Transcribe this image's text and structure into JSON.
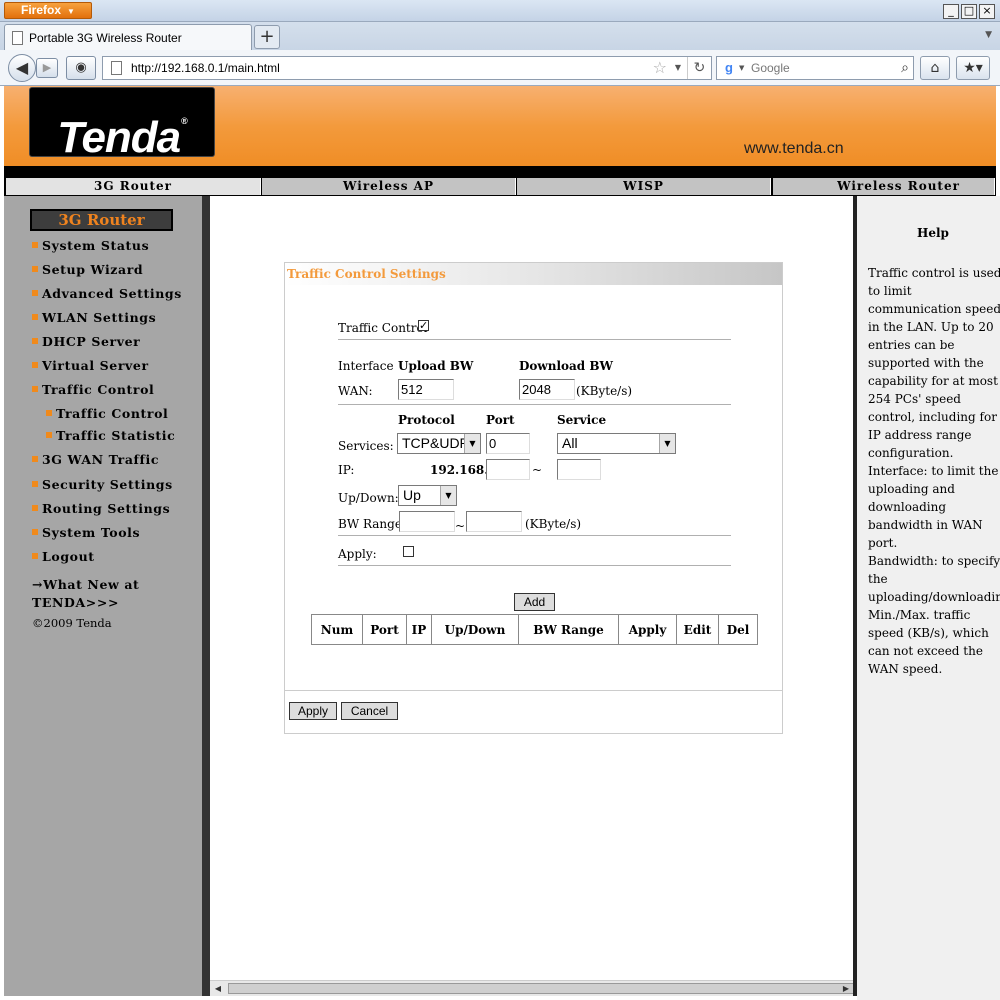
{
  "browser": {
    "menu_label": "Firefox",
    "tab_title": "Portable 3G Wireless Router",
    "new_tab_label": "+",
    "url": "http://192.168.0.1/main.html",
    "search_placeholder": "Google",
    "window_buttons": [
      "_",
      "□",
      "×"
    ]
  },
  "banner": {
    "logo_text": "Tenda",
    "logo_mark": "®",
    "website": "www.tenda.cn"
  },
  "modes": [
    "3G Router",
    "Wireless AP",
    "WISP",
    "Wireless Router"
  ],
  "active_mode": "3G Router",
  "sidebar": {
    "title": "3G Router",
    "items": [
      "System Status",
      "Setup Wizard",
      "Advanced Settings",
      "WLAN Settings",
      "DHCP Server",
      "Virtual Server",
      "Traffic Control"
    ],
    "subitems": [
      "Traffic Control",
      "Traffic Statistic"
    ],
    "items2": [
      "3G WAN Traffic",
      "Security Settings",
      "Routing Settings",
      "System Tools",
      "Logout"
    ],
    "whats_new": "→What New at TENDA>>>",
    "copyright": "©2009 Tenda"
  },
  "form": {
    "title": "Traffic Control Settings",
    "traffic_control_label": "Traffic Control",
    "traffic_control_checked": true,
    "interface_label": "Interface",
    "upload_bw_label": "Upload BW",
    "download_bw_label": "Download BW",
    "wan_label": "WAN:",
    "upload_bw_value": "512",
    "download_bw_value": "2048",
    "kbytes_unit": "(KByte/s)",
    "protocol_label": "Protocol",
    "port_label": "Port",
    "service_label": "Service",
    "services_label": "Services:",
    "protocol_value": "TCP&UDP",
    "port_value": "0",
    "service_value": "All",
    "ip_label": "IP:",
    "ip_prefix": "192.168.0.",
    "ip_start": "",
    "ip_end": "",
    "tilde": "~",
    "updown_label": "Up/Down:",
    "updown_value": "Up",
    "bw_range_label": "BW Range:",
    "bw_min": "",
    "bw_max": "",
    "apply_label": "Apply:",
    "apply_checked": false,
    "add_button": "Add",
    "table_headers": [
      "Num",
      "Port",
      "IP",
      "Up/Down",
      "BW Range",
      "Apply",
      "Edit",
      "Del"
    ],
    "apply_button": "Apply",
    "cancel_button": "Cancel"
  },
  "help": {
    "title": "Help",
    "text": "Traffic control is used to limit communication speed in the LAN. Up to 20 entries can be supported with the capability for at most 254 PCs' speed control, including for IP address range configuration.\nInterface: to limit the uploading and downloading bandwidth in WAN port.\nBandwidth: to specify the uploading/downloading Min./Max. traffic speed (KB/s), which can not exceed the WAN speed."
  },
  "colors": {
    "accent": "#f39a3c",
    "sidebar_bg": "#a6a6a6",
    "banner_orange": "#ef8a20"
  }
}
